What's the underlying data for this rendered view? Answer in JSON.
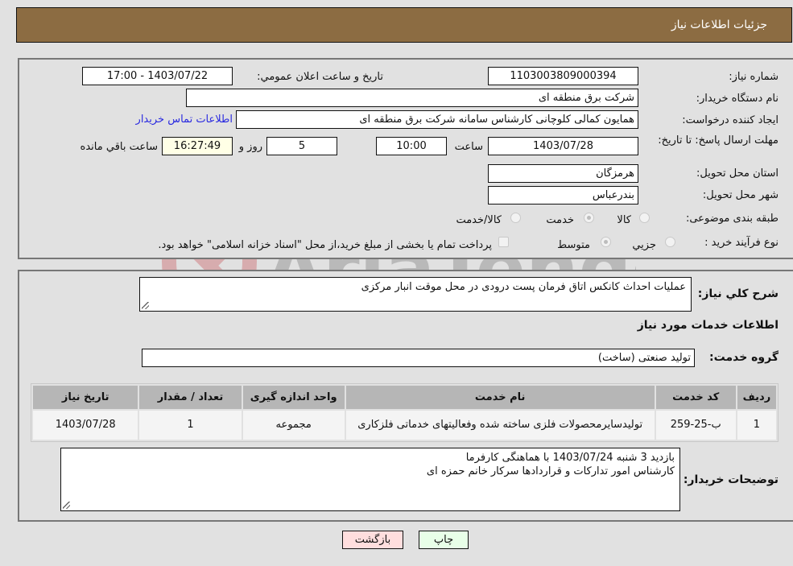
{
  "header": {
    "title": "جزئیات اطلاعات نیاز"
  },
  "form": {
    "need_number": {
      "label": "شماره نیاز:",
      "value": "1103003809000394"
    },
    "announce_datetime": {
      "label": "تاریخ و ساعت اعلان عمومي:",
      "value": "1403/07/22 - 17:00"
    },
    "buyer_org": {
      "label": "نام دستگاه خریدار:",
      "value": "شرکت برق منطقه ای"
    },
    "requester": {
      "label": "ایجاد کننده درخواست:",
      "value": "همایون کمالی کلوچانی کارشناس سامانه شرکت برق منطقه ای"
    },
    "buyer_contact_link": "اطلاعات تماس خریدار",
    "deadline": {
      "label": "مهلت ارسال پاسخ: تا تاریخ:",
      "date": "1403/07/28",
      "time_label": "ساعت",
      "time": "10:00",
      "days": "5",
      "days_label": "روز و",
      "remaining": "16:27:49",
      "remaining_label": "ساعت باقي مانده"
    },
    "province": {
      "label": "استان محل تحویل:",
      "value": "هرمزگان"
    },
    "city": {
      "label": "شهر محل تحویل:",
      "value": "بندرعباس"
    },
    "category": {
      "label": "طبقه بندی موضوعی:",
      "options": [
        "کالا",
        "خدمت",
        "کالا/خدمت"
      ],
      "selected": "خدمت"
    },
    "purchase_process": {
      "label": "نوع فرآیند خرید :",
      "options": [
        "جزيي",
        "متوسط"
      ],
      "selected": "متوسط",
      "treasury_note": "پرداخت تمام یا بخشی از مبلغ خرید،از محل \"اسناد خزانه اسلامی\" خواهد بود."
    }
  },
  "details": {
    "description_label": "شرح كلي نياز:",
    "description": "عملیات احداث کانکس اتاق فرمان پست درودی در محل موقت انبار مرکزی",
    "services_heading": "اطلاعات خدمات مورد نياز",
    "service_group_label": "گروه خدمت:",
    "service_group": "تولید صنعتی (ساخت)",
    "table": {
      "headers": [
        "رديف",
        "کد خدمت",
        "نام خدمت",
        "واحد اندازه گیری",
        "تعداد / مقدار",
        "تاریخ نیاز"
      ],
      "rows": [
        [
          "1",
          "ب-25-259",
          "تولیدسایرمحصولات فلزی ساخته شده وفعالیتهای خدماتی فلزکاری",
          "مجموعه",
          "1",
          "1403/07/28"
        ]
      ]
    },
    "buyer_notes_label": "توضیحات خریدار:",
    "buyer_notes_lines": [
      "بازدید 3 شنبه 1403/07/24 با هماهنگی کارفرما",
      "کارشناس امور تدارکات و قراردادها سرکار خانم حمزه ای"
    ]
  },
  "buttons": {
    "print": "چاپ",
    "back": "بازگشت"
  },
  "watermark": {
    "text": "AriaTender.neT"
  }
}
